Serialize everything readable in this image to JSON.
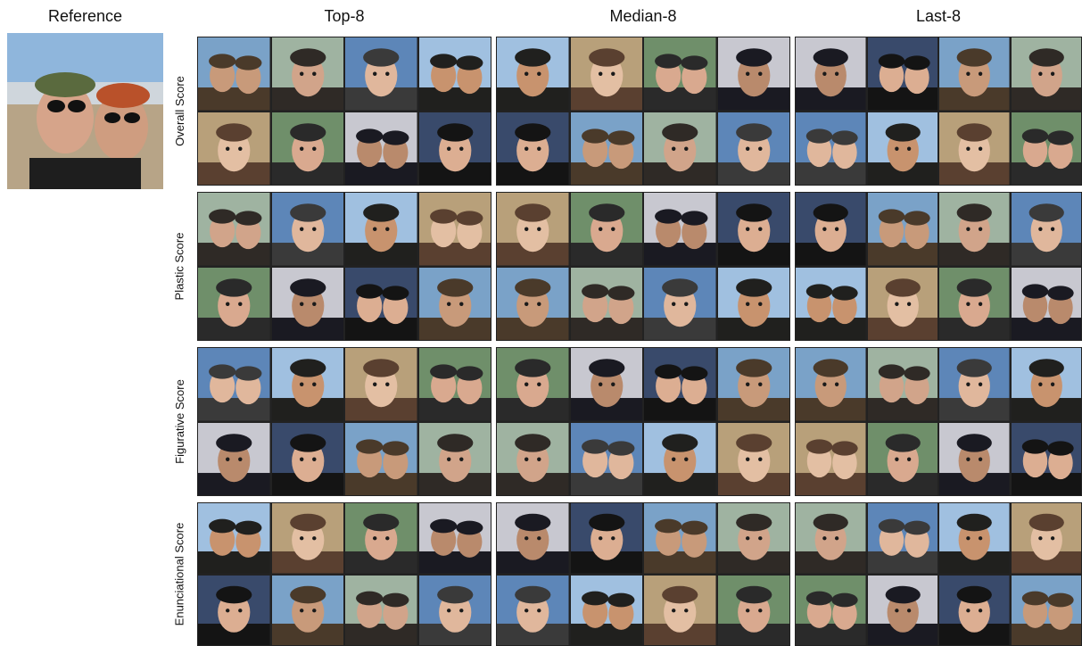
{
  "headers": {
    "reference": "Reference",
    "top": "Top-8",
    "median": "Median-8",
    "last": "Last-8"
  },
  "rows": [
    {
      "label": "Overall Score"
    },
    {
      "label": "Plastic Score"
    },
    {
      "label": "Figurative Score"
    },
    {
      "label": "Enunciational Score"
    }
  ],
  "palette": [
    [
      "#7aa2c8",
      "#c89a7a",
      "#4a3a2a"
    ],
    [
      "#9fb3a1",
      "#d1a48a",
      "#2f2a26"
    ],
    [
      "#5d86b8",
      "#e0b79c",
      "#3a3a3a"
    ],
    [
      "#a0c0e0",
      "#c8936e",
      "#20201e"
    ],
    [
      "#b8a07a",
      "#e3bfa3",
      "#5a4030"
    ],
    [
      "#6f8f6a",
      "#d9a98f",
      "#2a2a2a"
    ],
    [
      "#c8c8d0",
      "#b98a6c",
      "#1a1a22"
    ],
    [
      "#394a6b",
      "#dcae92",
      "#141414"
    ]
  ]
}
